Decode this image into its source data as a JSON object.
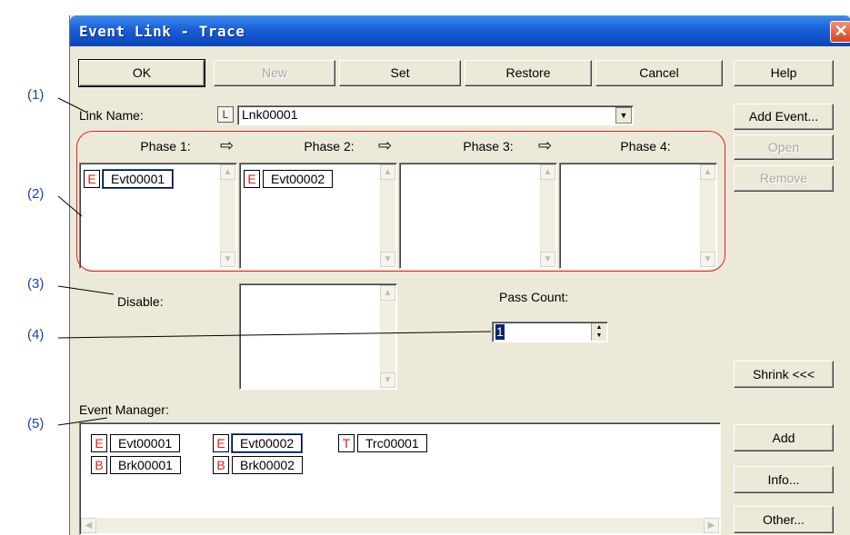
{
  "window": {
    "title": "Event Link - Trace",
    "close_glyph": "✕"
  },
  "toolbar": {
    "ok": "OK",
    "new": "New",
    "set": "Set",
    "restore": "Restore",
    "cancel": "Cancel",
    "help": "Help"
  },
  "side_buttons": {
    "add_event": "Add Event...",
    "open": "Open",
    "remove": "Remove",
    "shrink": "Shrink <<<",
    "add": "Add",
    "info": "Info...",
    "other": "Other..."
  },
  "link_name": {
    "label": "Link Name:",
    "icon_glyph": "L",
    "value": "Lnk00001"
  },
  "phases": [
    {
      "label": "Phase 1:",
      "events": [
        {
          "icon": "E",
          "name": "Evt00001"
        }
      ]
    },
    {
      "label": "Phase 2:",
      "events": [
        {
          "icon": "E",
          "name": "Evt00002"
        }
      ]
    },
    {
      "label": "Phase 3:",
      "events": []
    },
    {
      "label": "Phase 4:",
      "events": []
    }
  ],
  "disable": {
    "label": "Disable:"
  },
  "pass_count": {
    "label": "Pass Count:",
    "value": "1"
  },
  "event_manager": {
    "label": "Event Manager:",
    "row1": [
      {
        "icon": "E",
        "name": "Evt00001"
      },
      {
        "icon": "E",
        "name": "Evt00002"
      },
      {
        "icon": "T",
        "name": "Trc00001"
      }
    ],
    "row2": [
      {
        "icon": "B",
        "name": "Brk00001"
      },
      {
        "icon": "B",
        "name": "Brk00002"
      }
    ]
  },
  "callouts": [
    "(1)",
    "(2)",
    "(3)",
    "(4)",
    "(5)"
  ],
  "colors": {
    "title_bar": "#1a5fd8",
    "highlight_oval": "#e02020",
    "callout_text": "#1a3fb4"
  }
}
